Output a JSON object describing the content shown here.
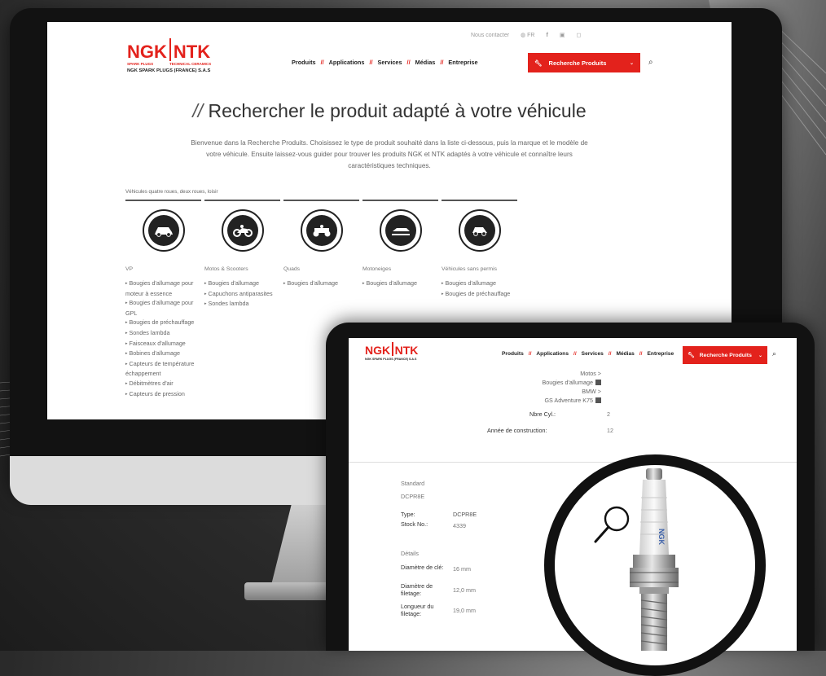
{
  "monitor": {
    "logo": {
      "brand_a": "NGK",
      "brand_b": "NTK",
      "sub_a": "SPARK PLUGS",
      "sub_b": "TECHNICAL CERAMICS",
      "company": "NGK SPARK PLUGS (FRANCE) S.A.S"
    },
    "topbar": {
      "contact": "Nous contacter",
      "language": "FR"
    },
    "nav": {
      "items": [
        "Produits",
        "Applications",
        "Services",
        "Médias",
        "Entreprise"
      ],
      "separator": "//"
    },
    "search_button": {
      "label": "Recherche Produits"
    },
    "title": {
      "slash": "//",
      "text": "Rechercher le produit adapté à votre véhicule"
    },
    "intro": "Bienvenue dans la Recherche Produits. Choisissez le type de produit souhaité dans la liste ci-dessous, puis la marque et le modèle de votre véhicule. Ensuite laissez-vous guider pour trouver les produits NGK et NTK adaptés à votre véhicule et connaître leurs caractéristiques techniques.",
    "category_caption": "Véhicules quatre roues, deux roues, loisir",
    "categories": [
      {
        "name": "VP",
        "items": [
          "Bougies d'allumage pour moteur à essence",
          "Bougies d'allumage pour GPL",
          "Bougies de préchauffage",
          "Sondes lambda",
          "Faisceaux d'allumage",
          "Bobines d'allumage",
          "Capteurs de température échappement",
          "Débitmètres d'air",
          "Capteurs de pression"
        ]
      },
      {
        "name": "Motos & Scooters",
        "items": [
          "Bougies d'allumage",
          "Capuchons antiparasites",
          "Sondes lambda"
        ]
      },
      {
        "name": "Quads",
        "items": [
          "Bougies d'allumage"
        ]
      },
      {
        "name": "Motoneiges",
        "items": [
          "Bougies d'allumage"
        ]
      },
      {
        "name": "Véhicules sans permis",
        "items": [
          "Bougies d'allumage",
          "Bougies de préchauffage"
        ]
      }
    ]
  },
  "tablet": {
    "nav": {
      "items": [
        "Produits",
        "Applications",
        "Services",
        "Médias",
        "Entreprise"
      ],
      "separator": "//"
    },
    "search_button": {
      "label": "Recherche Produits"
    },
    "breadcrumb": [
      "Motos >",
      "Bougies d'allumage",
      "BMW >",
      "GS Adventure K75"
    ],
    "specs": [
      {
        "label": "Nbre Cyl.:",
        "value": "2"
      },
      {
        "label": "Année de construction:",
        "value": "12"
      }
    ],
    "product": {
      "section": "Standard",
      "code": "DCPR8E",
      "type_label": "Type:",
      "type_value": "DCPR8E",
      "stock_label": "Stock No.:",
      "stock_value": "4339",
      "details": "Détails",
      "rows": [
        {
          "label": "Diamètre de clé:",
          "value": "16 mm"
        },
        {
          "label": "Diamètre de filetage:",
          "value": "12,0 mm"
        },
        {
          "label": "Longueur du filetage:",
          "value": "19,0 mm"
        }
      ]
    },
    "plug_logo": "NGK"
  },
  "colors": {
    "brand_red": "#e3221c",
    "frame": "#121212"
  }
}
